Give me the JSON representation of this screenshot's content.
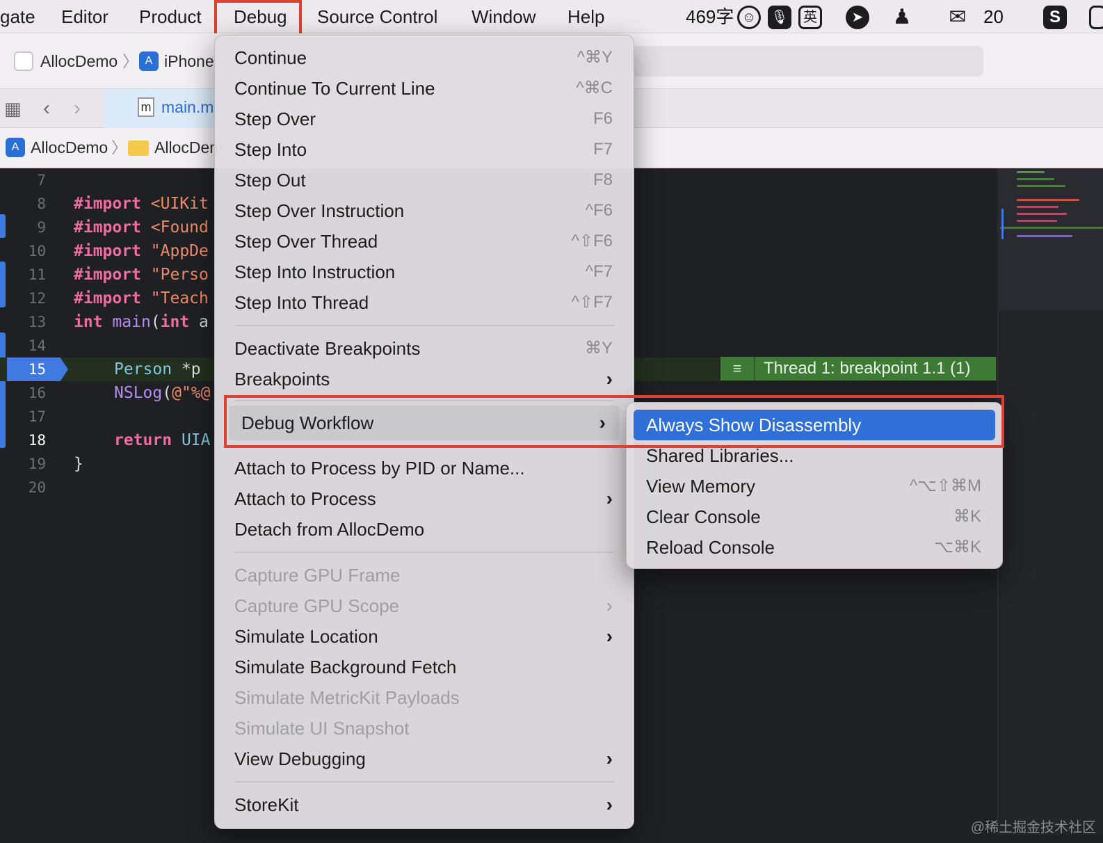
{
  "menubar": {
    "items": [
      "gate",
      "Editor",
      "Product",
      "Debug",
      "Source Control",
      "Window",
      "Help"
    ],
    "status": {
      "word_count": "469字",
      "ime_label": "英",
      "number": "20"
    }
  },
  "toolbar": {
    "scheme": "AllocDemo",
    "destination": "iPhone"
  },
  "tabs": {
    "active_file": "main.m",
    "file_glyph": "m"
  },
  "jumpbar": {
    "project": "AllocDemo",
    "folder": "AllocDem"
  },
  "editor": {
    "lines": [
      {
        "n": "7"
      },
      {
        "n": "8"
      },
      {
        "n": "9"
      },
      {
        "n": "10"
      },
      {
        "n": "11"
      },
      {
        "n": "12"
      },
      {
        "n": "13"
      },
      {
        "n": "14"
      },
      {
        "n": "15"
      },
      {
        "n": "16"
      },
      {
        "n": "17"
      },
      {
        "n": "18"
      },
      {
        "n": "19"
      },
      {
        "n": "20"
      }
    ],
    "code": {
      "l8_kw": "#import",
      "l8_rest": " <UIKit",
      "l9_kw": "#import",
      "l9_rest": " <Found",
      "l10_kw": "#import",
      "l10_rest": " \"AppDe",
      "l11_kw": "#import",
      "l11_rest": " \"Perso",
      "l12_kw": "#import",
      "l12_rest": " \"Teach",
      "l13_kw": "int",
      "l13_fn": "main",
      "l13_p": "(",
      "l13_kw2": "int",
      "l13_rest": " a",
      "l15_typ": "Person",
      "l15_rest": " *p",
      "l16_fn": "NSLog",
      "l16_p": "(",
      "l16_str": "@\"%@",
      "l18_kw": "return",
      "l18_rest": " UIA",
      "l19": "}"
    },
    "thread_badge": "Thread 1: breakpoint 1.1 (1)"
  },
  "debug_menu": {
    "items": [
      {
        "label": "Continue",
        "shortcut": "^⌘Y"
      },
      {
        "label": "Continue To Current Line",
        "shortcut": "^⌘C"
      },
      {
        "label": "Step Over",
        "shortcut": "F6"
      },
      {
        "label": "Step Into",
        "shortcut": "F7"
      },
      {
        "label": "Step Out",
        "shortcut": "F8"
      },
      {
        "label": "Step Over Instruction",
        "shortcut": "^F6"
      },
      {
        "label": "Step Over Thread",
        "shortcut": "^⇧F6"
      },
      {
        "label": "Step Into Instruction",
        "shortcut": "^F7"
      },
      {
        "label": "Step Into Thread",
        "shortcut": "^⇧F7"
      },
      {
        "label": "Deactivate Breakpoints",
        "shortcut": "⌘Y"
      },
      {
        "label": "Breakpoints",
        "shortcut": ""
      },
      {
        "label": "Debug Workflow",
        "shortcut": ""
      },
      {
        "label": "Attach to Process by PID or Name...",
        "shortcut": ""
      },
      {
        "label": "Attach to Process",
        "shortcut": ""
      },
      {
        "label": "Detach from AllocDemo",
        "shortcut": ""
      },
      {
        "label": "Capture GPU Frame",
        "shortcut": ""
      },
      {
        "label": "Capture GPU Scope",
        "shortcut": ""
      },
      {
        "label": "Simulate Location",
        "shortcut": ""
      },
      {
        "label": "Simulate Background Fetch",
        "shortcut": ""
      },
      {
        "label": "Simulate MetricKit Payloads",
        "shortcut": ""
      },
      {
        "label": "Simulate UI Snapshot",
        "shortcut": ""
      },
      {
        "label": "View Debugging",
        "shortcut": ""
      },
      {
        "label": "StoreKit",
        "shortcut": ""
      }
    ],
    "submenu_arrow": "›"
  },
  "workflow_submenu": {
    "items": [
      {
        "label": "Always Show Disassembly",
        "shortcut": ""
      },
      {
        "label": "Shared Libraries...",
        "shortcut": ""
      },
      {
        "label": "View Memory",
        "shortcut": "^⌥⇧⌘M"
      },
      {
        "label": "Clear Console",
        "shortcut": "⌘K"
      },
      {
        "label": "Reload Console",
        "shortcut": "⌥⌘K"
      }
    ]
  },
  "watermark": "@稀土掘金技术社区",
  "colors": {
    "highlight_box": "#e0412f",
    "selection_blue": "#2f6fd8",
    "breakpoint_blue": "#3f7be0",
    "thread_green": "#3e7a36"
  }
}
